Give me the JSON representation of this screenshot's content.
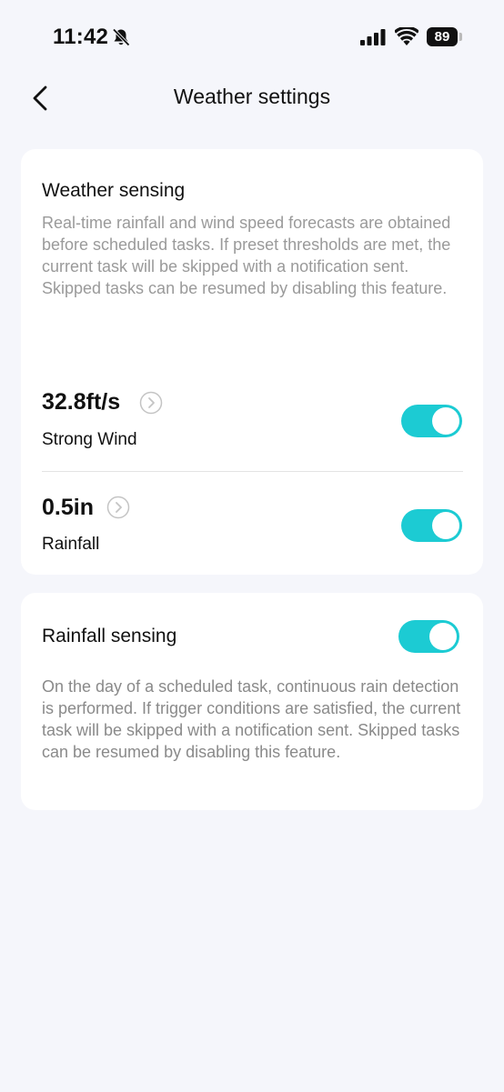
{
  "status_bar": {
    "time": "11:42",
    "battery": "89",
    "icons": [
      "bell-off-icon",
      "signal-icon",
      "wifi-icon",
      "battery-icon"
    ]
  },
  "header": {
    "title": "Weather settings",
    "back_icon": "chevron-left-icon"
  },
  "weather_sensing": {
    "title": "Weather sensing",
    "description": "Real-time rainfall and wind speed forecasts are obtained before scheduled tasks. If preset thresholds are met, the current task will be skipped with a notification sent. Skipped tasks can be resumed by disabling this feature.",
    "items": [
      {
        "value": "32.8ft/s",
        "label": "Strong Wind",
        "enabled": true
      },
      {
        "value": "0.5in",
        "label": "Rainfall",
        "enabled": true
      }
    ]
  },
  "rainfall_sensing": {
    "title": "Rainfall sensing",
    "enabled": true,
    "description": "On the day of a scheduled task, continuous rain detection is performed. If trigger conditions are satisfied, the current task will be skipped with a notification sent. Skipped tasks can be resumed by disabling this feature."
  },
  "colors": {
    "accent": "#1ccbd3",
    "background": "#f5f6fb",
    "card": "#ffffff",
    "muted_text": "#9a9a9a"
  }
}
